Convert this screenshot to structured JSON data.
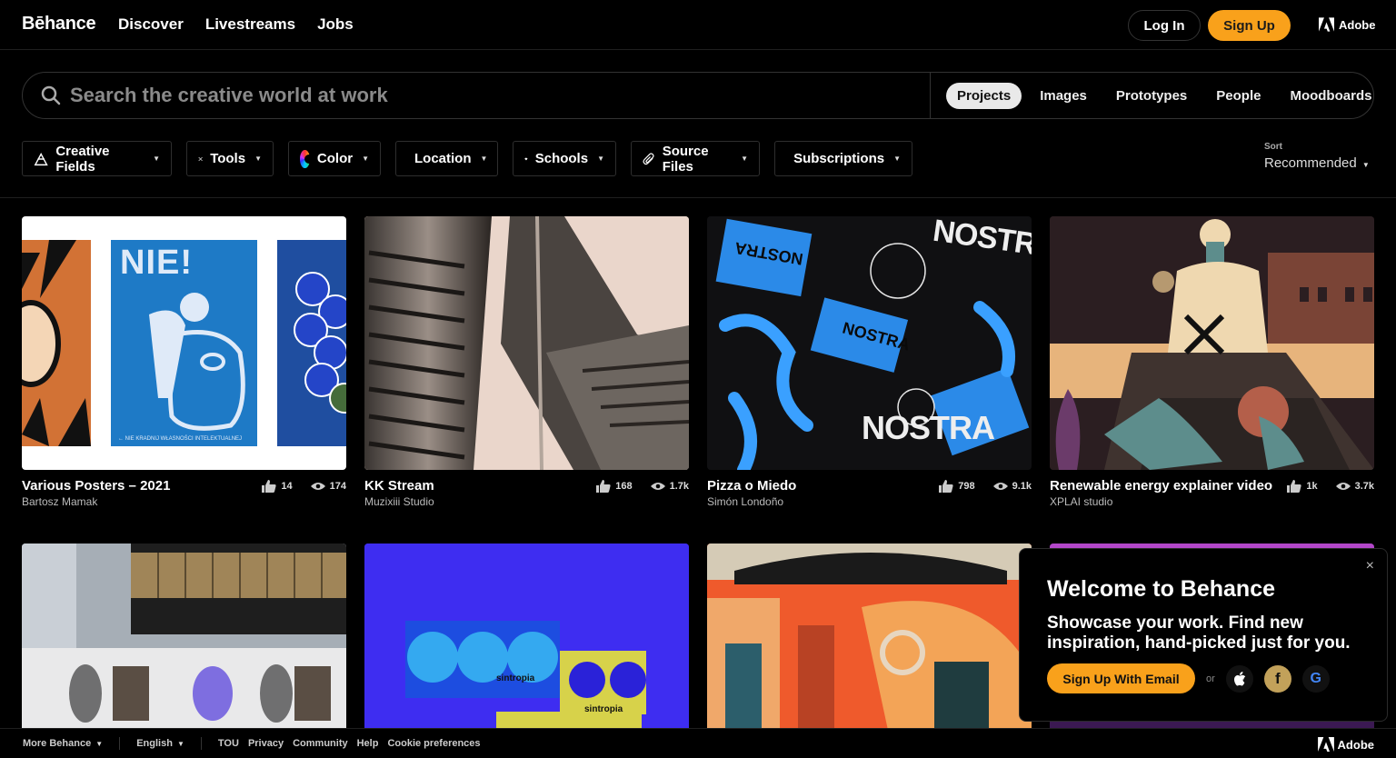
{
  "header": {
    "logo": "Bēhance",
    "nav": [
      "Discover",
      "Livestreams",
      "Jobs"
    ],
    "login": "Log In",
    "signup": "Sign Up",
    "adobe": "Adobe"
  },
  "search": {
    "placeholder": "Search the creative world at work",
    "tabs": [
      "Projects",
      "Images",
      "Prototypes",
      "People",
      "Moodboards"
    ],
    "active_tab": "Projects"
  },
  "filters": {
    "items": [
      "Creative Fields",
      "Tools",
      "Color",
      "Location",
      "Schools",
      "Source Files",
      "Subscriptions"
    ],
    "sort_label": "Sort",
    "sort_value": "Recommended"
  },
  "projects": [
    {
      "title": "Various Posters – 2021",
      "owner": "Bartosz Mamak",
      "likes": "14",
      "views": "174"
    },
    {
      "title": "KK Stream",
      "owner": "Muzixiii Studio",
      "likes": "168",
      "views": "1.7k"
    },
    {
      "title": "Pizza o Miedo",
      "owner": "Simón Londoño",
      "likes": "798",
      "views": "9.1k"
    },
    {
      "title": "Renewable energy explainer video",
      "owner": "XPLAI studio",
      "likes": "1k",
      "views": "3.7k"
    }
  ],
  "thumb_text": {
    "poster_word": "NIE!",
    "poster_caption": "← NIE KRADNIJ WŁASNOŚCI INTELEKTUALNEJ",
    "brand": "NOSTRA",
    "sintropia": "sintropia"
  },
  "popup": {
    "title": "Welcome to Behance",
    "subtitle": "Showcase your work. Find new inspiration, hand-picked just for you.",
    "email_button": "Sign Up With Email",
    "or": "or",
    "close": "×"
  },
  "footer": {
    "more": "More Behance",
    "language": "English",
    "links": [
      "TOU",
      "Privacy",
      "Community",
      "Help",
      "Cookie preferences"
    ],
    "adobe": "Adobe"
  },
  "colors": {
    "accent": "#f9a11b",
    "background": "#000000"
  }
}
